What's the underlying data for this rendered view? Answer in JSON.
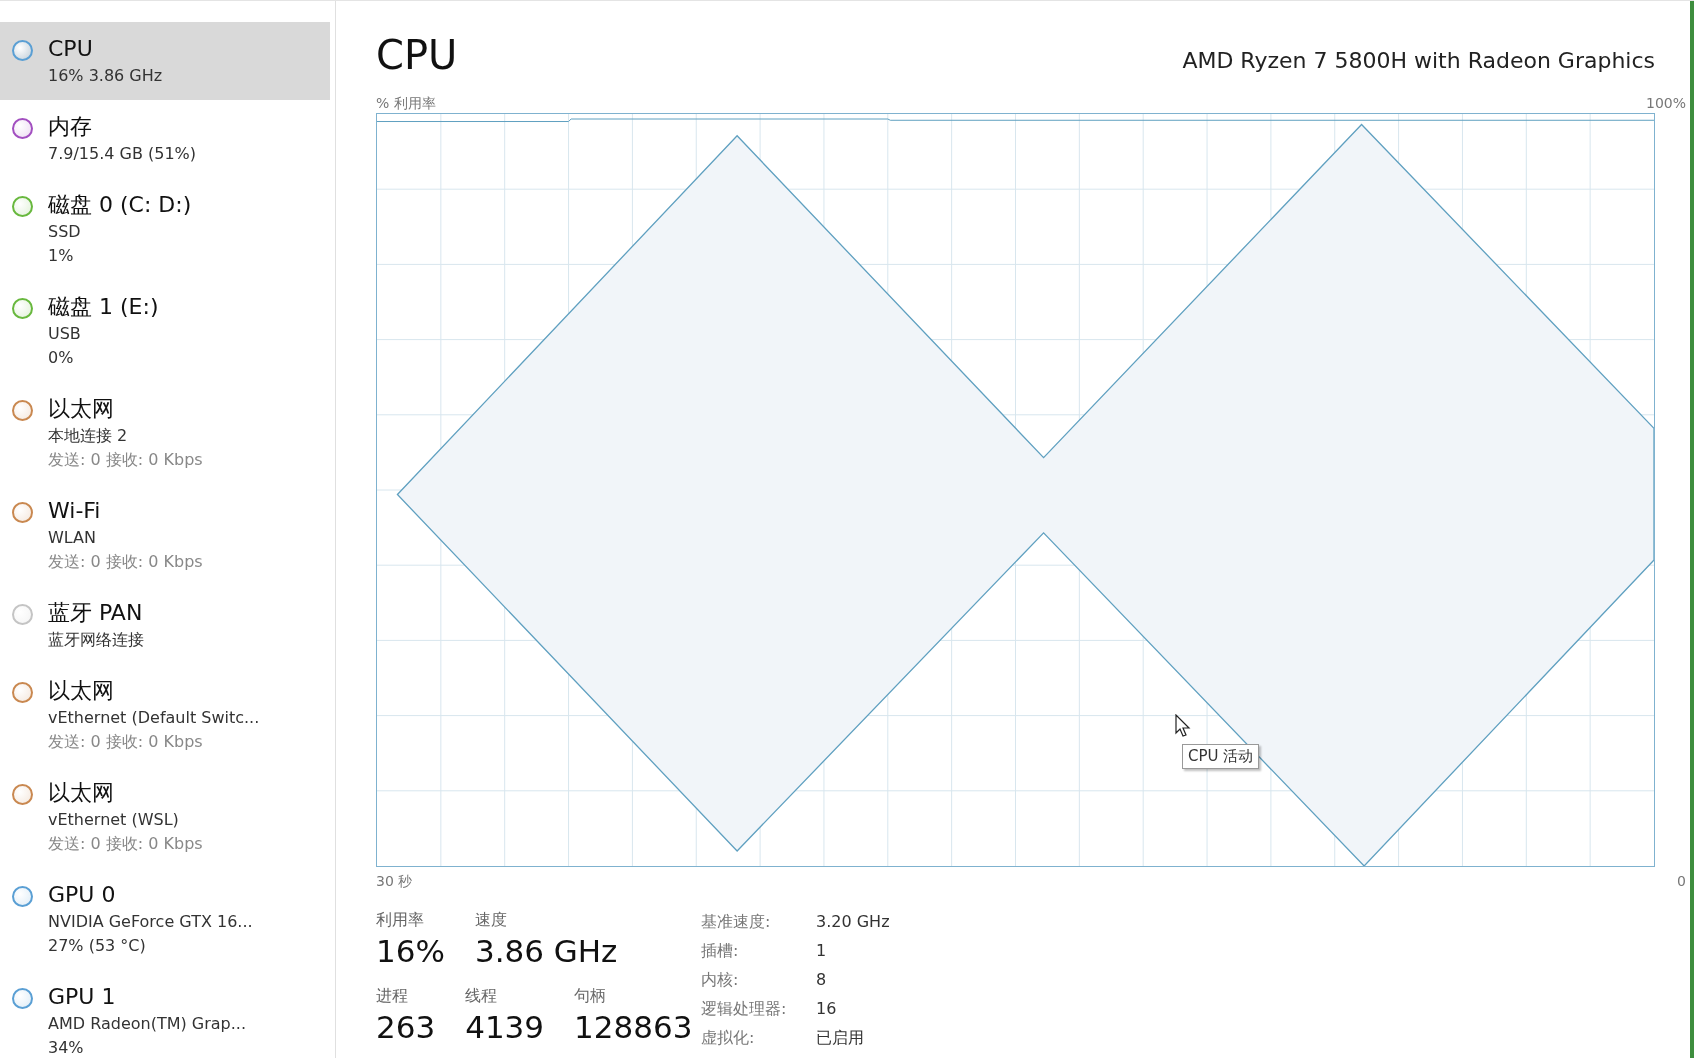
{
  "sidebar": {
    "items": [
      {
        "name": "CPU",
        "color": "#5a9fd4",
        "selected": true,
        "lines": [
          "16%  3.86 GHz"
        ]
      },
      {
        "name": "内存",
        "color": "#a24fc0",
        "selected": false,
        "lines": [
          "7.9/15.4 GB (51%)"
        ]
      },
      {
        "name": "磁盘 0 (C: D:)",
        "color": "#68b83e",
        "selected": false,
        "lines": [
          "SSD",
          "1%"
        ]
      },
      {
        "name": "磁盘 1 (E:)",
        "color": "#68b83e",
        "selected": false,
        "lines": [
          "USB",
          "0%"
        ]
      },
      {
        "name": "以太网",
        "color": "#c98850",
        "selected": false,
        "lines": [
          "本地连接 2"
        ],
        "traffic": "发送: 0 接收: 0 Kbps"
      },
      {
        "name": "Wi-Fi",
        "color": "#c98850",
        "selected": false,
        "lines": [
          "WLAN"
        ],
        "traffic": "发送: 0 接收: 0 Kbps"
      },
      {
        "name": "蓝牙 PAN",
        "color": "#c4c4c4",
        "selected": false,
        "lines": [
          "蓝牙网络连接"
        ]
      },
      {
        "name": "以太网",
        "color": "#c98850",
        "selected": false,
        "lines": [
          "vEthernet (Default Switc..."
        ],
        "traffic": "发送: 0 接收: 0 Kbps"
      },
      {
        "name": "以太网",
        "color": "#c98850",
        "selected": false,
        "lines": [
          "vEthernet (WSL)"
        ],
        "traffic": "发送: 0 接收: 0 Kbps"
      },
      {
        "name": "GPU 0",
        "color": "#5a9fd4",
        "selected": false,
        "lines": [
          "NVIDIA GeForce GTX 16...",
          "27% (53 °C)"
        ]
      },
      {
        "name": "GPU 1",
        "color": "#5a9fd4",
        "selected": false,
        "lines": [
          "AMD Radeon(TM) Grap...",
          "34%"
        ]
      }
    ]
  },
  "header": {
    "title": "CPU",
    "model": "AMD Ryzen 7 5800H with Radeon Graphics"
  },
  "graph": {
    "y_label": "% 利用率",
    "y_max_label": "100%",
    "x_start_label": "30 秒",
    "x_end_label": "0",
    "tooltip": "CPU 活动"
  },
  "stats": {
    "rows": [
      [
        {
          "label": "利用率",
          "value": "16%"
        },
        {
          "label": "速度",
          "value": "3.86 GHz"
        }
      ],
      [
        {
          "label": "进程",
          "value": "263"
        },
        {
          "label": "线程",
          "value": "4139"
        },
        {
          "label": "句柄",
          "value": "128863"
        }
      ]
    ],
    "details": [
      {
        "label": "基准速度:",
        "value": "3.20 GHz"
      },
      {
        "label": "插槽:",
        "value": "1"
      },
      {
        "label": "内核:",
        "value": "8"
      },
      {
        "label": "逻辑处理器:",
        "value": "16"
      },
      {
        "label": "虚拟化:",
        "value": "已启用"
      }
    ]
  }
}
